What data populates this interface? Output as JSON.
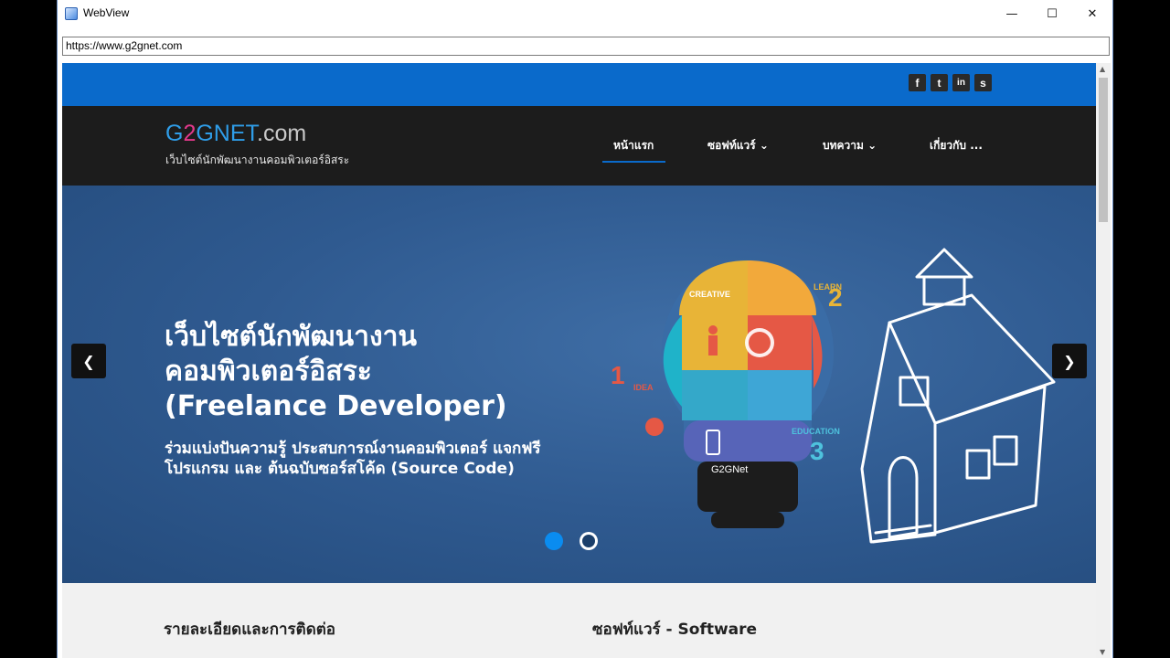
{
  "window": {
    "title": "WebView",
    "controls": {
      "minimize": "—",
      "maximize": "☐",
      "close": "✕"
    }
  },
  "address_bar": {
    "url": "https://www.g2gnet.com"
  },
  "social": [
    "f",
    "t",
    "in",
    "s"
  ],
  "site": {
    "logo": {
      "g": "G",
      "two": "2",
      "gnet": "GNET",
      "dotcom": ".com"
    },
    "tagline": "เว็บไซต์นักพัฒนางานคอมพิวเตอร์อิสระ",
    "nav": [
      {
        "label": "หน้าแรก",
        "active": true
      },
      {
        "label": "ซอฟท์แวร์",
        "dropdown": true
      },
      {
        "label": "บทความ",
        "dropdown": true
      },
      {
        "label": "เกี่ยวกับ ..."
      }
    ],
    "nav_caret": "⌄"
  },
  "hero": {
    "title_line1": "เว็บไซต์นักพัฒนางาน",
    "title_line2": "คอมพิวเตอร์อิสระ",
    "title_line3": "(Freelance Developer)",
    "subtitle": "ร่วมแบ่งปันความรู้ ประสบการณ์งานคอมพิวเตอร์ แจกฟรีโปรแกรม และ ต้นฉบับซอร์สโค้ด (Source Code)",
    "prev": "❮",
    "next": "❯",
    "illustration_labels": {
      "creative": "CREATIVE",
      "learn": "LEARN",
      "idea": "IDEA",
      "education": "EDUCATION",
      "brand": "G2GNet"
    },
    "slides": 2,
    "active_slide": 1,
    "colors": {
      "dot_active": "#0a8cf0",
      "dot_inactive": "#ffffff"
    }
  },
  "sections": {
    "left_title": "รายละเอียดและการติดต่อ",
    "right_title": "ซอฟท์แวร์ - Software"
  },
  "colors": {
    "topbar": "#0a6acb",
    "header": "#1c1c1c",
    "hero": "#2f5a90"
  }
}
